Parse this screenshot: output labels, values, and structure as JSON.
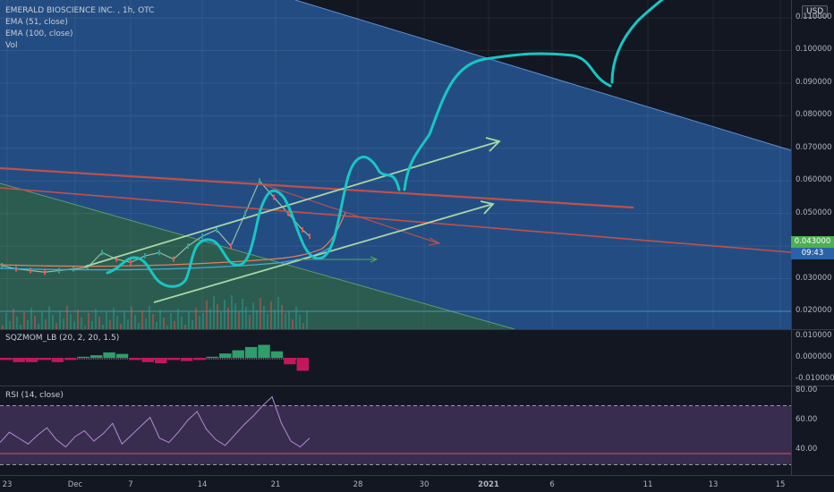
{
  "header": {
    "title": "EMERALD BIOSCIENCE INC. , 1h, OTC",
    "indicators": [
      "EMA (51, close)",
      "EMA (100, close)",
      "Vol"
    ],
    "currency": "USD"
  },
  "price_tags": {
    "last_price": "0.043000",
    "countdown": "09:43"
  },
  "colors": {
    "background": "#131722",
    "upper_triangle": "#2a62a8",
    "lower_triangle": "#2e5e4a",
    "cyan_drawing": "#18c6c4",
    "channel": "#a7d7a5",
    "red_line": "#c0504d",
    "rsi_band": "#5a3f74"
  },
  "chart_data": [
    {
      "type": "line",
      "pane": "price",
      "title": "EMERALD BIOSCIENCE INC. , 1h, OTC",
      "y_ticks": [
        "0.110000",
        "0.100000",
        "0.090000",
        "0.080000",
        "0.070000",
        "0.060000",
        "0.050000",
        "0.040000",
        "0.030000",
        "0.020000"
      ],
      "y_tick_values": [
        0.11,
        0.1,
        0.09,
        0.08,
        0.07,
        0.06,
        0.05,
        0.04,
        0.03,
        0.02
      ],
      "ylim": [
        0.0145,
        0.1155
      ],
      "x_ticks": [
        "23",
        "Dec",
        "7",
        "14",
        "21",
        "28",
        "30",
        "2021",
        "6",
        "11",
        "13",
        "15"
      ],
      "series": [
        {
          "name": "",
          "x_index": [
            0,
            4,
            8,
            12,
            16,
            20,
            24,
            28,
            32,
            36,
            40,
            44,
            48,
            52,
            56,
            60,
            64,
            68,
            72,
            76,
            80,
            84,
            86
          ],
          "values": [
            0.034,
            0.033,
            0.0325,
            0.032,
            0.0325,
            0.033,
            0.0335,
            0.038,
            0.036,
            0.035,
            0.037,
            0.038,
            0.036,
            0.04,
            0.043,
            0.045,
            0.04,
            0.05,
            0.06,
            0.055,
            0.05,
            0.045,
            0.043
          ]
        }
      ],
      "last_price": 0.043
    },
    {
      "type": "bar",
      "pane": "oscillator",
      "title": "SQZMOM_LB (20, 2, 20, 1.5)",
      "y_ticks": [
        "0.010000",
        "0.000000",
        "-0.010000"
      ],
      "y_tick_values": [
        0.01,
        0.0,
        -0.01
      ],
      "ylim": [
        -0.012,
        0.012
      ],
      "values": [
        -0.001,
        -0.002,
        -0.002,
        -0.001,
        -0.002,
        -0.001,
        0.0005,
        0.0012,
        0.0025,
        0.0018,
        -0.001,
        -0.002,
        -0.0025,
        -0.001,
        -0.0015,
        -0.001,
        0.0005,
        0.002,
        0.0035,
        0.005,
        0.006,
        0.003,
        -0.003,
        -0.006
      ]
    },
    {
      "type": "line",
      "pane": "rsi",
      "title": "RSI (14, close)",
      "y_ticks": [
        "80.00",
        "60.00",
        "40.00"
      ],
      "y_tick_values": [
        80,
        60,
        40
      ],
      "ylim": [
        23,
        83
      ],
      "band": [
        30,
        70
      ],
      "series": [
        {
          "name": "",
          "values": [
            45,
            52,
            48,
            44,
            50,
            55,
            47,
            42,
            49,
            53,
            46,
            51,
            58,
            44,
            50,
            56,
            62,
            48,
            45,
            52,
            60,
            66,
            54,
            47,
            43,
            50,
            57,
            63,
            70,
            76,
            58,
            46,
            42,
            48
          ]
        }
      ]
    }
  ]
}
